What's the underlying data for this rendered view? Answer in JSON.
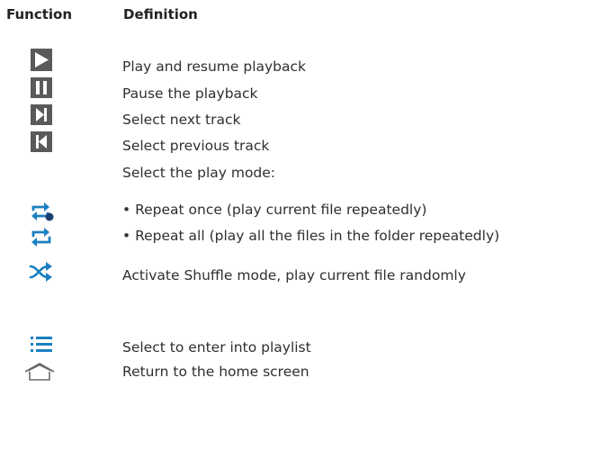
{
  "headers": {
    "function": "Function",
    "definition": "Definition"
  },
  "rows": [
    {
      "icon": "play-icon",
      "text": "Play and resume playback"
    },
    {
      "icon": "pause-icon",
      "text": "Pause the playback"
    },
    {
      "icon": "next-track-icon",
      "text": "Select next track"
    },
    {
      "icon": "previous-track-icon",
      "text": "Select previous track"
    },
    {
      "icon": "",
      "text": "Select the play mode:"
    },
    {
      "icon": "repeat-once-icon",
      "text": "• Repeat once (play current file repeatedly)"
    },
    {
      "icon": "repeat-all-icon",
      "text": "• Repeat all (play all the files in the folder repeatedly)"
    },
    {
      "icon": "shuffle-icon",
      "text": "Activate Shuffle mode, play current file randomly"
    },
    {
      "icon": "playlist-icon",
      "text": "Select to enter into playlist"
    },
    {
      "icon": "home-icon",
      "text": "Return to the home screen"
    }
  ],
  "colors": {
    "transport_icon_bg": "#5a5a5a",
    "mode_icon": "#1b7fc1",
    "home_icon": "#6b6b6b"
  }
}
